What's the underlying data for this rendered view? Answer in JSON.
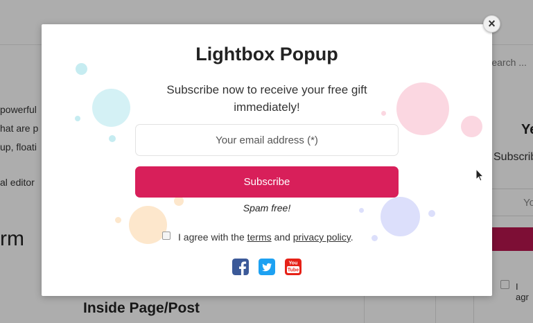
{
  "background": {
    "search_placeholder": "Search ...",
    "lines": [
      "powerful",
      "hat are p",
      "up, floati",
      "al editor"
    ],
    "form_word": "rm",
    "inside_heading": "Inside Page/Post",
    "right_popup": {
      "title": "Ye",
      "subtitle": "Subscrib",
      "input_text": "Yo",
      "agree_text": "I agr"
    }
  },
  "popup": {
    "title": "Lightbox Popup",
    "subtitle": "Subscribe now to receive your free gift immediately!",
    "email_placeholder": "Your email address (*)",
    "subscribe_label": "Subscribe",
    "spam_text": "Spam free!",
    "agree_prefix": "I agree with the ",
    "terms_link": "terms",
    "agree_middle": " and ",
    "privacy_link": "privacy policy",
    "agree_suffix": ".",
    "close_label": "×",
    "social_icons": [
      "facebook-icon",
      "twitter-icon",
      "youtube-icon"
    ],
    "youtube_text": "You Tube"
  },
  "colors": {
    "subscribe_button": "#d81f5a",
    "facebook": "#3b5998",
    "twitter": "#1da1f2",
    "youtube": "#e62117"
  }
}
